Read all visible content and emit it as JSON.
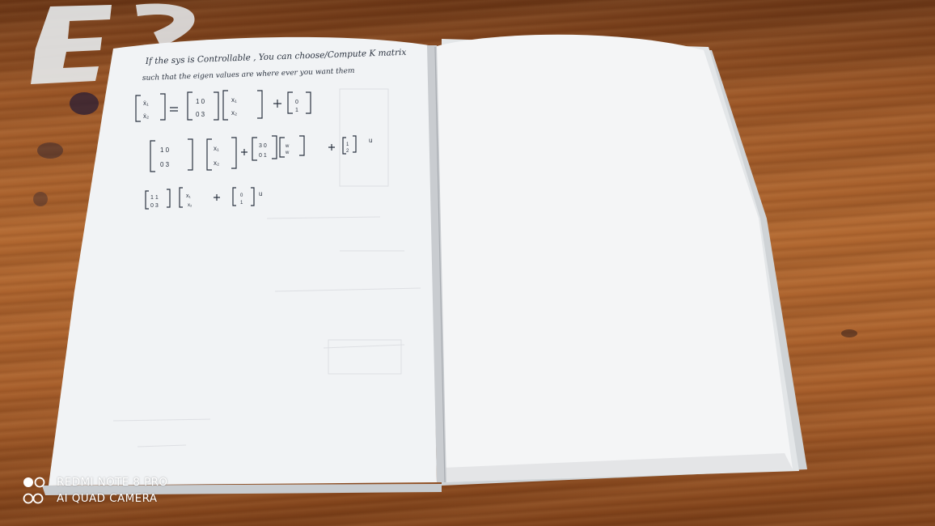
{
  "watermark": {
    "line1": "REDMI NOTE 8 PRO",
    "line2": "AI QUAD CAMERA"
  },
  "desk_marking": "E2",
  "notebook": {
    "heading_line1": "If the sys is Controllable , You can choose/Compute K matrix",
    "heading_line2": "such that the eigen values are where ever you want them",
    "icons": {
      "watermark_top": "two-dots-icon",
      "watermark_bottom": "two-rings-icon"
    }
  }
}
